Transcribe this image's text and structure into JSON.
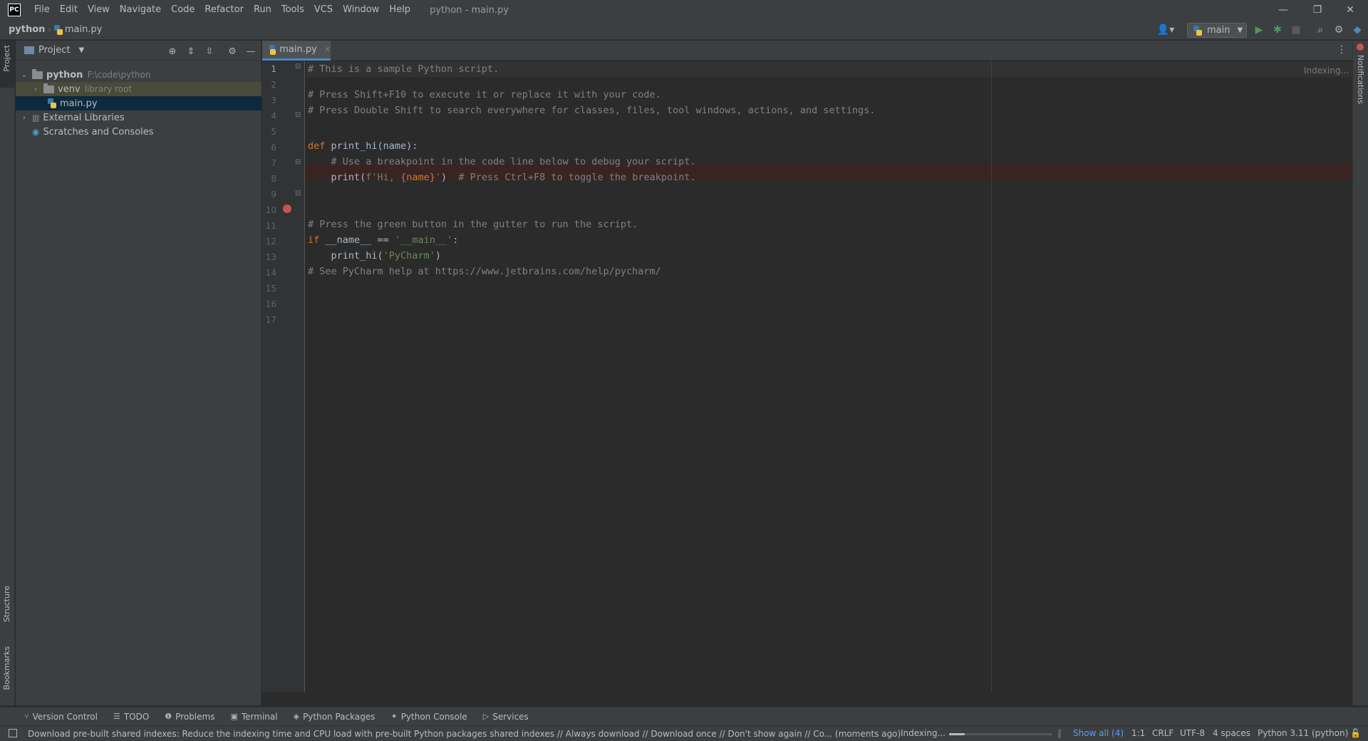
{
  "app": {
    "logo_text": "PC",
    "window_title": "python - main.py"
  },
  "menu": [
    "File",
    "Edit",
    "View",
    "Navigate",
    "Code",
    "Refactor",
    "Run",
    "Tools",
    "VCS",
    "Window",
    "Help"
  ],
  "breadcrumb": {
    "project": "python",
    "file": "main.py"
  },
  "run_config": {
    "label": "main"
  },
  "left_strip": {
    "project": "Project",
    "structure": "Structure",
    "bookmarks": "Bookmarks"
  },
  "right_strip": {
    "notifications": "Notifications"
  },
  "project_panel": {
    "title": "Project",
    "tree": [
      {
        "label": "python",
        "hint": "F:\\code\\python",
        "expanded": true
      },
      {
        "label": "venv",
        "hint": "library root",
        "expanded": false
      },
      {
        "label": "main.py",
        "hint": ""
      },
      {
        "label": "External Libraries",
        "hint": ""
      },
      {
        "label": "Scratches and Consoles",
        "hint": ""
      }
    ]
  },
  "editor": {
    "tab": "main.py",
    "indexing": "Indexing...",
    "line_numbers": [
      "1",
      "2",
      "3",
      "4",
      "5",
      "6",
      "7",
      "8",
      "9",
      "10",
      "11",
      "12",
      "13",
      "14",
      "15",
      "16",
      "17"
    ],
    "lines": {
      "l1": "# This is a sample Python script.",
      "l3": "# Press Shift+F10 to execute it or replace it with your code.",
      "l4": "# Press Double Shift to search everywhere for classes, files, tool windows, actions, and settings.",
      "l7_kw": "def",
      "l7_rest": " print_hi(name):",
      "l8": "    # Use a breakpoint in the code line below to debug your script.",
      "l9_a": "    print(",
      "l9_str1": "f'Hi, ",
      "l9_b": "{name}",
      "l9_str2": "'",
      "l9_c": ")  ",
      "l9_cm": "# Press Ctrl+F8 to toggle the breakpoint.",
      "l12": "# Press the green button in the gutter to run the script.",
      "l13_kw": "if",
      "l13_a": " __name__ == ",
      "l13_str": "'__main__'",
      "l13_b": ":",
      "l14_a": "    print_hi(",
      "l14_str": "'PyCharm'",
      "l14_b": ")",
      "l16": "# See PyCharm help at https://www.jetbrains.com/help/pycharm/"
    }
  },
  "bottom_tools": [
    "Version Control",
    "TODO",
    "Problems",
    "Terminal",
    "Python Packages",
    "Python Console",
    "Services"
  ],
  "status": {
    "message": "Download pre-built shared indexes: Reduce the indexing time and CPU load with pre-built Python packages shared indexes // Always download // Download once // Don't show again // Co... (moments ago)",
    "indexing": "Indexing...",
    "progress": 0.15,
    "show_all": "Show all (4)",
    "position": "1:1",
    "line_sep": "CRLF",
    "encoding": "UTF-8",
    "indent": "4 spaces",
    "interpreter": "Python 3.11 (python)"
  },
  "colors": {
    "accent": "#4a88c7",
    "run_green": "#499c54",
    "breakpoint": "#c75450",
    "keyword": "#cc7832",
    "string": "#6a8759",
    "comment": "#808080"
  }
}
